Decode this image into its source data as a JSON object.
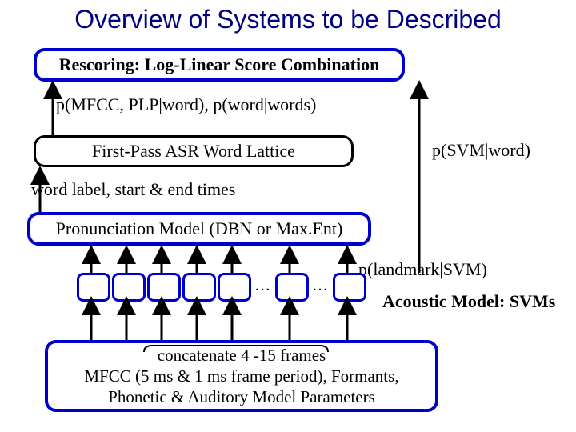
{
  "title": "Overview of Systems to be Described",
  "boxes": {
    "rescoring": "Rescoring: Log-Linear Score Combination",
    "firstpass": "First-Pass ASR Word Lattice",
    "pronmodel": "Pronunciation Model (DBN or Max.Ent)",
    "bottom_line1": "concatenate 4 -15 frames",
    "bottom_line2": "MFCC (5 ms & 1 ms frame period), Formants,",
    "bottom_line3": "Phonetic & Auditory Model Parameters"
  },
  "labels": {
    "p_mfcc": "p(MFCC, PLP|word), p(word|words)",
    "p_svm_word": "p(SVM|word)",
    "word_label": "word label, start & end times",
    "p_landmark": "p(landmark|SVM)",
    "acoustic": "Acoustic Model: SVMs"
  },
  "ellipsis": "…"
}
